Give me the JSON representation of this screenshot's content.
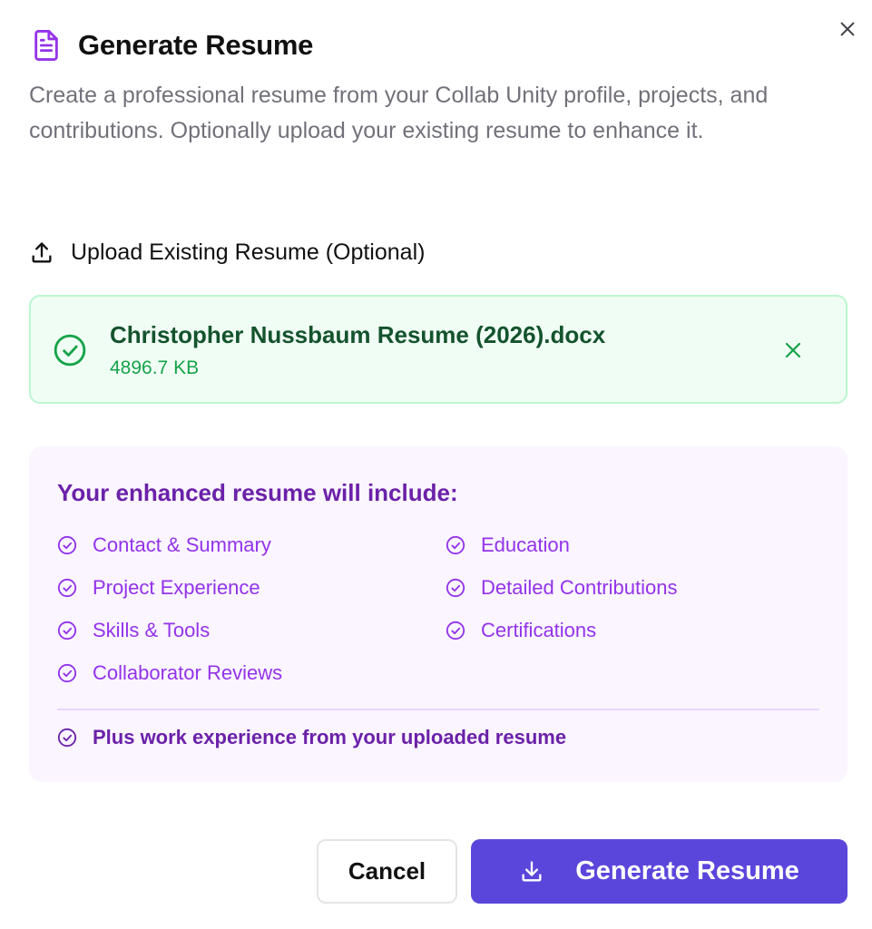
{
  "dialog": {
    "title": "Generate Resume",
    "description": "Create a professional resume from your Collab Unity profile, projects, and contributions. Optionally upload your existing resume to enhance it.",
    "close_icon": "close-icon",
    "title_icon": "file-text-icon"
  },
  "upload": {
    "label": "Upload Existing Resume (Optional)",
    "icon": "upload-icon",
    "file": {
      "name": "Christopher Nussbaum Resume (2026).docx",
      "size": "4896.7 KB",
      "status_icon": "check-circle-icon",
      "remove_icon": "close-icon"
    }
  },
  "includes": {
    "title": "Your enhanced resume will include:",
    "items": [
      "Contact & Summary",
      "Education",
      "Project Experience",
      "Detailed Contributions",
      "Skills & Tools",
      "Certifications",
      "Collaborator Reviews"
    ],
    "extra": "Plus work experience from your uploaded resume"
  },
  "actions": {
    "cancel_label": "Cancel",
    "generate_label": "Generate Resume",
    "generate_icon": "download-icon"
  },
  "colors": {
    "accent": "#5b46dc",
    "title_icon": "#9333ea",
    "success_bg": "#f0fdf4",
    "success_border": "#bbf7d0",
    "success_text": "#14532d",
    "success_subtext": "#16a34a",
    "info_bg": "#faf5ff",
    "info_title": "#6b21a8",
    "info_item": "#9333ea"
  }
}
